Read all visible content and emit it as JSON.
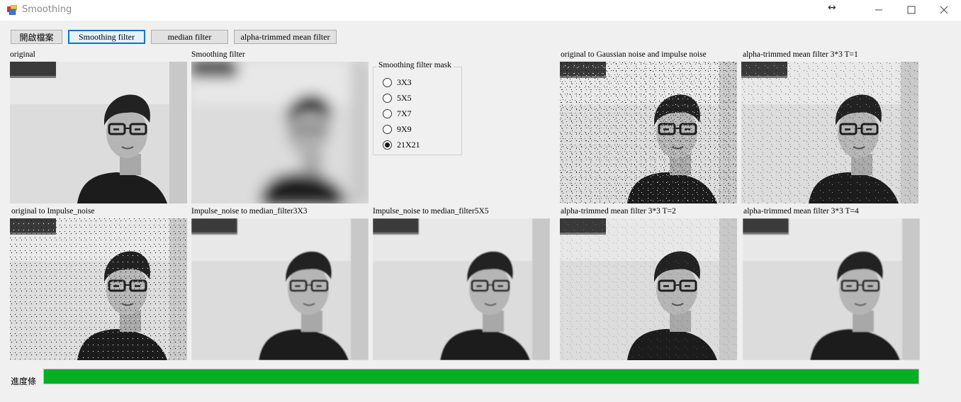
{
  "window": {
    "title": "Smoothing"
  },
  "toolbar": {
    "open_label": "開啟檔案",
    "smoothing_label": "Smoothing filter",
    "median_label": "median filter",
    "alpha_label": "alpha-trimmed mean filter"
  },
  "images": {
    "original": "original",
    "smoothing": "Smoothing filter",
    "gaussian_impulse": "original to Gaussian noise and impulse noise",
    "alpha_t1": "alpha-trimmed mean filter 3*3 T=1",
    "impulse": "original to Impulse_noise",
    "median3": "Impulse_noise to median_filter3X3",
    "median5": "Impulse_noise to median_filter5X5",
    "alpha_t2": "alpha-trimmed mean filter 3*3 T=2",
    "alpha_t4": "alpha-trimmed mean filter 3*3 T=4"
  },
  "mask_group": {
    "title": "Smoothing filter mask",
    "options": [
      "3X3",
      "5X5",
      "7X7",
      "9X9",
      "21X21"
    ],
    "selected": "21X21"
  },
  "progress": {
    "label": "進度條",
    "value_percent": 100
  },
  "colors": {
    "accent": "#0078d7",
    "progress": "#06b025"
  },
  "icons": [
    "app-icon",
    "resize-icon",
    "minimize-icon",
    "maximize-icon",
    "close-icon"
  ]
}
